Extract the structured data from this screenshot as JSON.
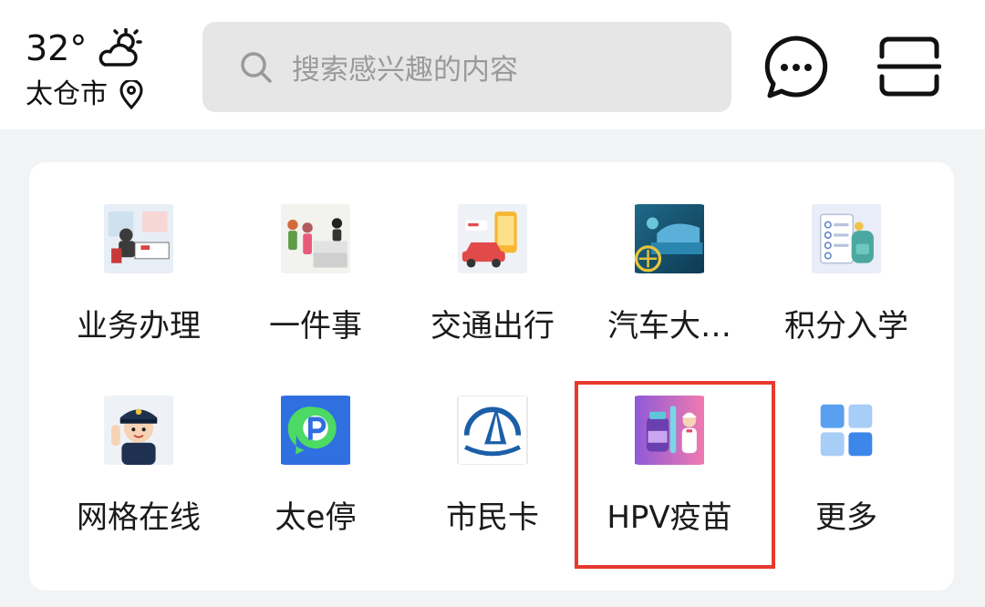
{
  "header": {
    "temperature": "32°",
    "city": "太仓市",
    "weather_icon": "partly-cloudy-icon",
    "search_placeholder": "搜索感兴趣的内容"
  },
  "services": [
    {
      "label": "业务办理",
      "icon": "service-counter-icon"
    },
    {
      "label": "一件事",
      "icon": "reception-desk-icon"
    },
    {
      "label": "交通出行",
      "icon": "car-map-icon"
    },
    {
      "label": "汽车大…",
      "icon": "car-service-icon"
    },
    {
      "label": "积分入学",
      "icon": "checklist-backpack-icon"
    },
    {
      "label": "网格在线",
      "icon": "police-officer-icon"
    },
    {
      "label": "太e停",
      "icon": "parking-app-icon"
    },
    {
      "label": "市民卡",
      "icon": "citizen-card-logo-icon"
    },
    {
      "label": "HPV疫苗",
      "icon": "hpv-vaccine-icon"
    },
    {
      "label": "更多",
      "icon": "more-grid-icon"
    }
  ],
  "highlighted_item": "HPV疫苗",
  "colors": {
    "highlight_border": "#e8392e",
    "page_background": "#f2f3f5",
    "search_background": "#e6e6e6"
  }
}
